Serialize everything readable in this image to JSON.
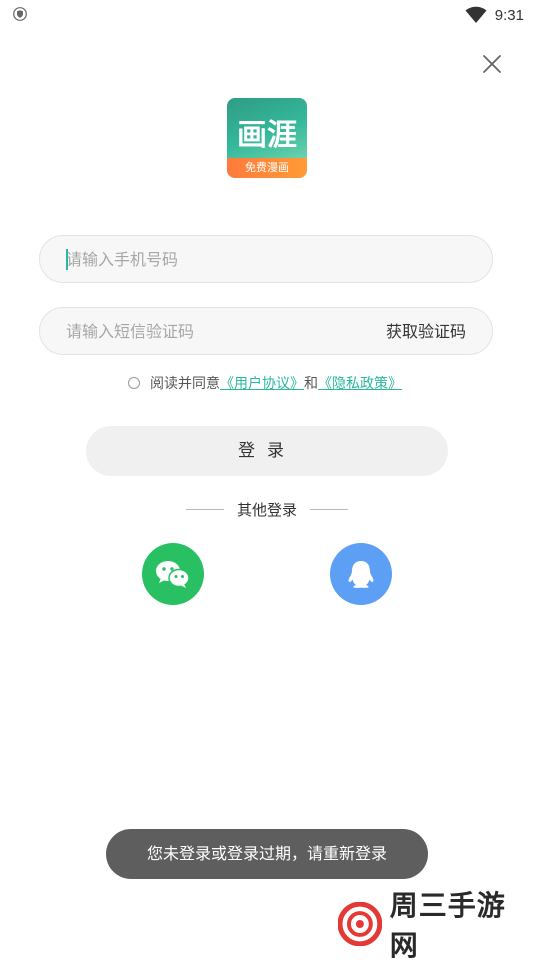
{
  "status_bar": {
    "time": "9:31",
    "left_icon": "shield-icon",
    "right_icon": "wifi-icon"
  },
  "logo": {
    "title": "画涯",
    "subtitle": "免费漫画",
    "colors": {
      "primary": "#34b79b",
      "band": "#ff8a38"
    }
  },
  "form": {
    "phone_placeholder": "请输入手机号码",
    "code_placeholder": "请输入短信验证码",
    "get_code_label": "获取验证码"
  },
  "agreement": {
    "prefix": "阅读并同意",
    "user_agreement": "《用户协议》",
    "and": "和",
    "privacy_policy": "《隐私政策》",
    "link_color": "#2bb8a0"
  },
  "login_button": {
    "label": "登录"
  },
  "other_login": {
    "label": "其他登录",
    "providers": [
      {
        "icon": "wechat-icon",
        "color": "#29c064"
      },
      {
        "icon": "qq-icon",
        "color": "#5c9ff4"
      }
    ]
  },
  "toast": {
    "message": "您未登录或登录过期，请重新登录"
  },
  "watermark": {
    "text": "周三手游网"
  }
}
